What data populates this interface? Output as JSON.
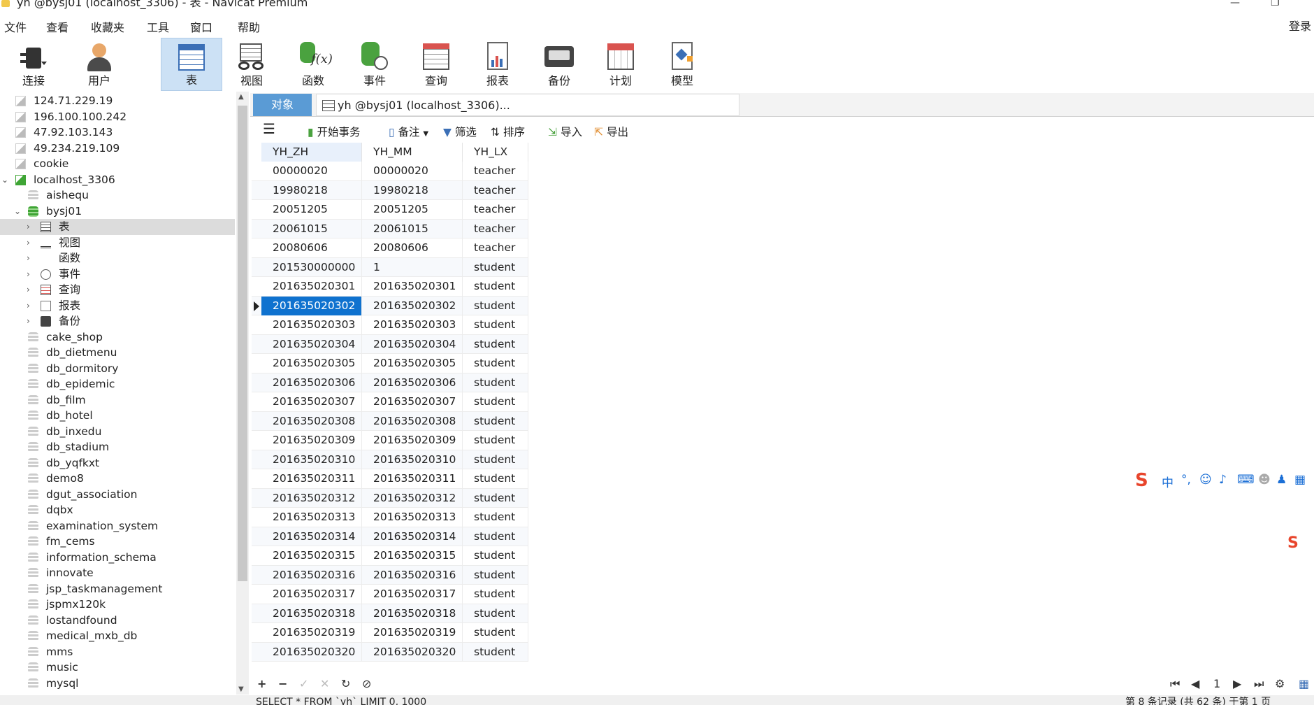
{
  "window": {
    "title": "yh @bysj01 (localhost_3306) - 表 - Navicat Premium",
    "min": "—",
    "max": "❐"
  },
  "menu": {
    "items": [
      "文件",
      "查看",
      "收藏夹",
      "工具",
      "窗口",
      "帮助"
    ],
    "login": "登录"
  },
  "toolbar": {
    "connect": "连接",
    "user": "用户",
    "table": "表",
    "view": "视图",
    "function": "函数",
    "event": "事件",
    "query": "查询",
    "report": "报表",
    "backup": "备份",
    "schedule": "计划",
    "model": "模型"
  },
  "sidebar": {
    "connections": [
      "124.71.229.19",
      "196.100.100.242",
      "47.92.103.143",
      "49.234.219.109",
      "cookie"
    ],
    "localhost": "localhost_3306",
    "aishequ": "aishequ",
    "bysj01": "bysj01",
    "bysj_children": [
      "表",
      "视图",
      "函数",
      "事件",
      "查询",
      "报表",
      "备份"
    ],
    "databases": [
      "cake_shop",
      "db_dietmenu",
      "db_dormitory",
      "db_epidemic",
      "db_film",
      "db_hotel",
      "db_inxedu",
      "db_stadium",
      "db_yqfkxt",
      "demo8",
      "dgut_association",
      "dqbx",
      "examination_system",
      "fm_cems",
      "information_schema",
      "innovate",
      "jsp_taskmanagement",
      "jspmx120k",
      "lostandfound",
      "medical_mxb_db",
      "mms",
      "music",
      "mysql"
    ]
  },
  "tabs": {
    "objects": "对象",
    "doc": "yh @bysj01 (localhost_3306)..."
  },
  "subtoolbar": {
    "begin_tx": "开始事务",
    "note": "备注",
    "filter": "筛选",
    "sort": "排序",
    "import": "导入",
    "export": "导出"
  },
  "table": {
    "columns": [
      "YH_ZH",
      "YH_MM",
      "YH_LX"
    ],
    "selected_row": 7,
    "rows": [
      [
        "00000020",
        "00000020",
        "teacher"
      ],
      [
        "19980218",
        "19980218",
        "teacher"
      ],
      [
        "20051205",
        "20051205",
        "teacher"
      ],
      [
        "20061015",
        "20061015",
        "teacher"
      ],
      [
        "20080606",
        "20080606",
        "teacher"
      ],
      [
        "201530000000",
        "1",
        "student"
      ],
      [
        "201635020301",
        "201635020301",
        "student"
      ],
      [
        "201635020302",
        "201635020302",
        "student"
      ],
      [
        "201635020303",
        "201635020303",
        "student"
      ],
      [
        "201635020304",
        "201635020304",
        "student"
      ],
      [
        "201635020305",
        "201635020305",
        "student"
      ],
      [
        "201635020306",
        "201635020306",
        "student"
      ],
      [
        "201635020307",
        "201635020307",
        "student"
      ],
      [
        "201635020308",
        "201635020308",
        "student"
      ],
      [
        "201635020309",
        "201635020309",
        "student"
      ],
      [
        "201635020310",
        "201635020310",
        "student"
      ],
      [
        "201635020311",
        "201635020311",
        "student"
      ],
      [
        "201635020312",
        "201635020312",
        "student"
      ],
      [
        "201635020313",
        "201635020313",
        "student"
      ],
      [
        "201635020314",
        "201635020314",
        "student"
      ],
      [
        "201635020315",
        "201635020315",
        "student"
      ],
      [
        "201635020316",
        "201635020316",
        "student"
      ],
      [
        "201635020317",
        "201635020317",
        "student"
      ],
      [
        "201635020318",
        "201635020318",
        "student"
      ],
      [
        "201635020319",
        "201635020319",
        "student"
      ],
      [
        "201635020320",
        "201635020320",
        "student"
      ]
    ]
  },
  "bottom": {
    "page": "1"
  },
  "status": {
    "sql": "SELECT * FROM `yh` LIMIT 0, 1000",
    "records": "第 8 条记录 (共 62 条) 于第 1 页"
  },
  "colors": {
    "accent": "#0f72cf",
    "tab_active": "#5a9bd5",
    "db_green": "#3fa535",
    "ime_red": "#e8452c"
  }
}
